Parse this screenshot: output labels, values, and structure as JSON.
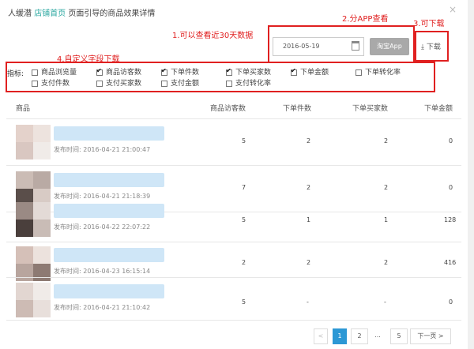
{
  "header": {
    "title_part1": "人缓潜",
    "title_link": "店铺首页",
    "title_part2": "页面引导的商品效果详情",
    "close": "×"
  },
  "annotations": {
    "a1": "1.可以查看近30天数据",
    "a2": "2.分APP查看",
    "a3": "3.可下载",
    "a4": "4.自定义字段下载"
  },
  "toolbar": {
    "date_value": "2016-05-19",
    "app_button": "淘宝App",
    "download_label": "下载"
  },
  "filters": {
    "label": "指标:",
    "options": [
      {
        "label": "商品浏览量",
        "checked": false
      },
      {
        "label": "商品访客数",
        "checked": true
      },
      {
        "label": "下单件数",
        "checked": true
      },
      {
        "label": "下单买家数",
        "checked": true
      },
      {
        "label": "下单金额",
        "checked": true
      },
      {
        "label": "下单转化率",
        "checked": false
      },
      {
        "label": "支付件数",
        "checked": false
      },
      {
        "label": "支付买家数",
        "checked": false
      },
      {
        "label": "支付金额",
        "checked": false
      },
      {
        "label": "支付转化率",
        "checked": false
      }
    ]
  },
  "table": {
    "columns": [
      "商品",
      "商品访客数",
      "下单件数",
      "下单买家数",
      "下单金额"
    ],
    "rows": [
      {
        "time": "发布时间: 2016-04-21 21:00:47",
        "visitors": "5",
        "items": "2",
        "buyers": "2",
        "amount": "0"
      },
      {
        "time": "发布时间: 2016-04-21 21:18:39",
        "visitors": "7",
        "items": "2",
        "buyers": "2",
        "amount": "0"
      },
      {
        "time": "发布时间: 2016-04-22 22:07:22",
        "visitors": "5",
        "items": "1",
        "buyers": "1",
        "amount": "128"
      },
      {
        "time": "发布时间: 2016-04-23 16:15:14",
        "visitors": "2",
        "items": "2",
        "buyers": "2",
        "amount": "416"
      },
      {
        "time": "发布时间: 2016-04-21 21:10:42",
        "visitors": "5",
        "items": "-",
        "buyers": "-",
        "amount": "0"
      }
    ]
  },
  "pagination": {
    "prev": "<",
    "pages": [
      "1",
      "2",
      "...",
      "5"
    ],
    "next": "下一页 >"
  }
}
